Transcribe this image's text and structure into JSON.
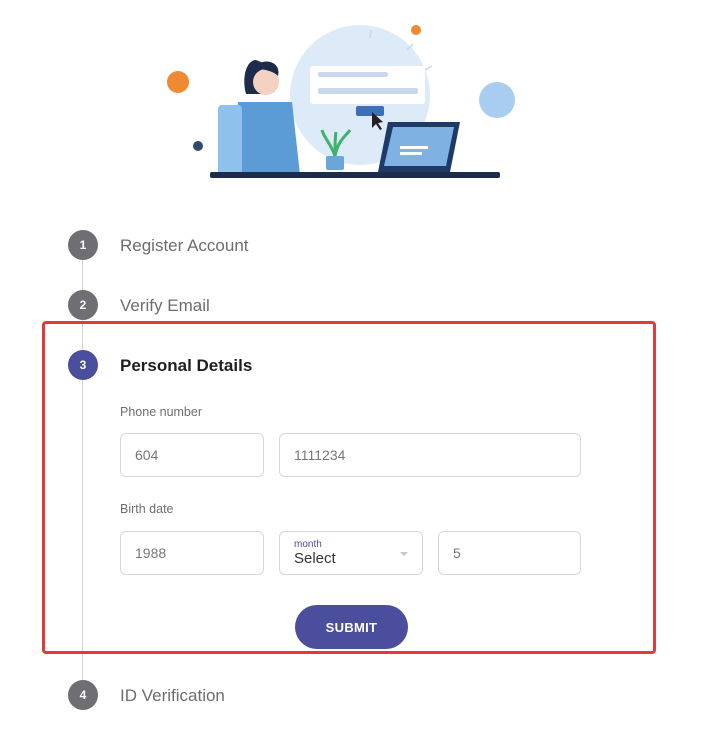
{
  "steps": [
    {
      "number": "1",
      "label": "Register Account"
    },
    {
      "number": "2",
      "label": "Verify Email"
    },
    {
      "number": "3",
      "label": "Personal Details"
    },
    {
      "number": "4",
      "label": "ID Verification"
    }
  ],
  "form": {
    "phone_label": "Phone number",
    "phone_area_code": "604",
    "phone_number": "1111234",
    "birth_label": "Birth date",
    "birth_year": "1988",
    "month_caption": "month",
    "month_value": "Select",
    "birth_day": "5",
    "submit_label": "SUBMIT"
  },
  "colors": {
    "accent": "#4a4e9c",
    "step_inactive": "#6e6e73",
    "highlight": "#e23a3a"
  }
}
